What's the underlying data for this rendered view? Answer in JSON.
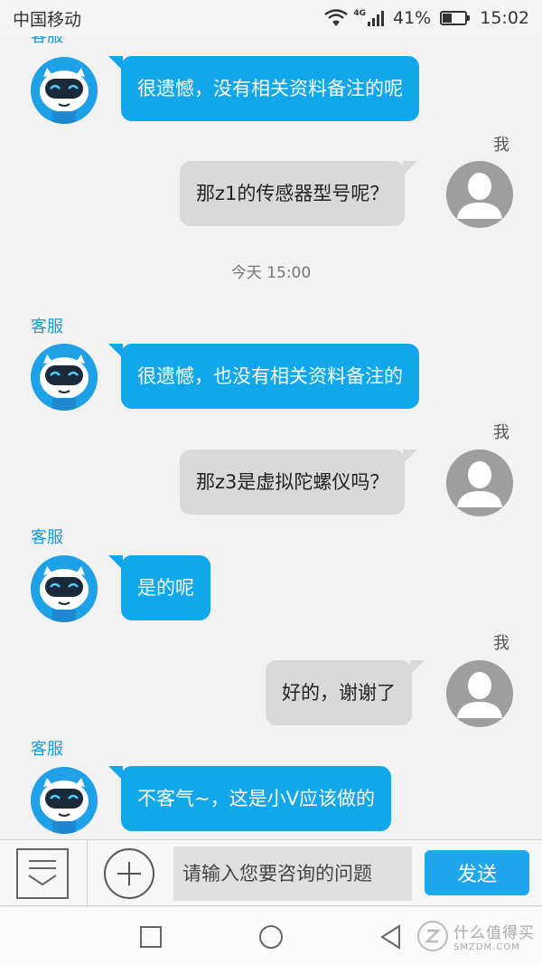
{
  "status_bar": {
    "carrier": "中国移动",
    "network": "4G",
    "battery": "41%",
    "battery_level": 0.41,
    "time": "15:02"
  },
  "chat": {
    "bot_name": "客服",
    "user_name": "我",
    "messages": [
      {
        "from": "bot",
        "text": "很遗憾，没有相关资料备注的呢"
      },
      {
        "from": "user",
        "text": "那z1的传感器型号呢？"
      },
      {
        "from": "time",
        "text": "今天 15:00"
      },
      {
        "from": "bot",
        "text": "很遗憾，也没有相关资料备注的"
      },
      {
        "from": "user",
        "text": "那z3是虚拟陀螺仪吗？"
      },
      {
        "from": "bot",
        "text": "是的呢"
      },
      {
        "from": "user",
        "text": "好的，谢谢了"
      },
      {
        "from": "bot",
        "text": "不客气~，这是小V应该做的"
      }
    ]
  },
  "input_bar": {
    "placeholder": "请输入您要咨询的问题",
    "send_label": "发送"
  },
  "watermark": {
    "main": "什么值得买",
    "sub": "SMZDM.COM"
  },
  "colors": {
    "accent": "#11a7ea",
    "user_bubble": "#d9d9d9",
    "background": "#f2f2f2"
  }
}
